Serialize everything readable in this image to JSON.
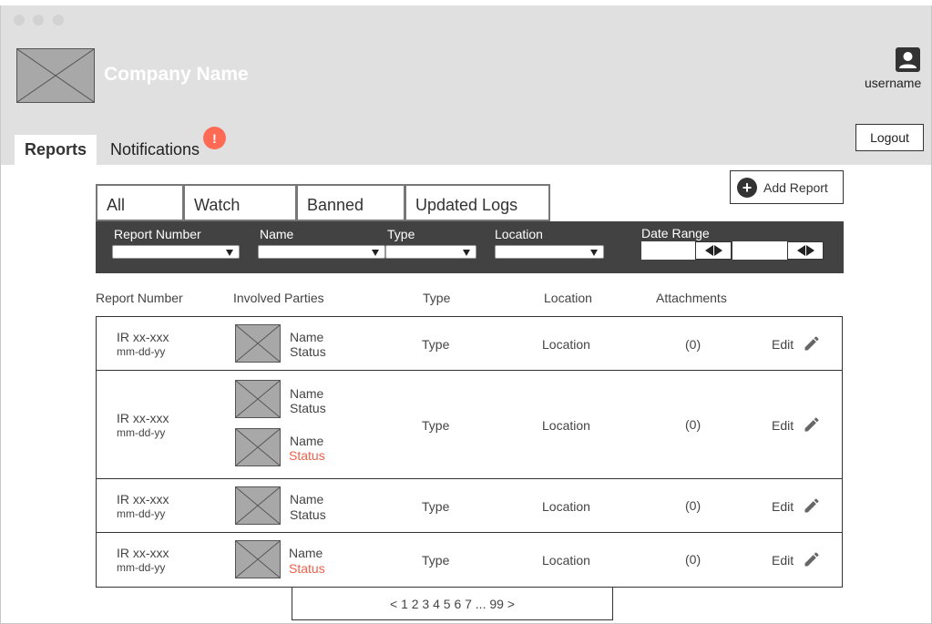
{
  "window": {
    "dots": [
      "window-dot",
      "window-dot",
      "window-dot"
    ]
  },
  "header": {
    "company_name": "Company Name",
    "username": "username",
    "logout_label": "Logout"
  },
  "nav": {
    "tabs": [
      {
        "label": "Reports",
        "active": true
      },
      {
        "label": "Notifications",
        "active": false
      }
    ],
    "notification_badge": "!"
  },
  "actions": {
    "add_report_label": "Add Report",
    "add_icon": "+"
  },
  "filter_tabs": [
    "All",
    "Watch",
    "Banned",
    "Updated Logs"
  ],
  "filters": {
    "report_number_label": "Report Number",
    "name_label": "Name",
    "type_label": "Type",
    "location_label": "Location",
    "date_range_label": "Date Range"
  },
  "table": {
    "headers": [
      "Report Number",
      "Involved Parties",
      "Type",
      "Location",
      "Attachments"
    ],
    "rows": [
      {
        "report_number": "IR xx-xxx",
        "date": "mm-dd-yy",
        "parties": [
          {
            "name": "Name",
            "status": "Status",
            "status_alert": false
          }
        ],
        "type": "Type",
        "location": "Location",
        "attachments": "(0)",
        "edit_label": "Edit"
      },
      {
        "report_number": "IR xx-xxx",
        "date": "mm-dd-yy",
        "parties": [
          {
            "name": "Name",
            "status": "Status",
            "status_alert": false
          },
          {
            "name": "Name",
            "status": "Status",
            "status_alert": true
          }
        ],
        "type": "Type",
        "location": "Location",
        "attachments": "(0)",
        "edit_label": "Edit"
      },
      {
        "report_number": "IR xx-xxx",
        "date": "mm-dd-yy",
        "parties": [
          {
            "name": "Name",
            "status": "Status",
            "status_alert": false
          }
        ],
        "type": "Type",
        "location": "Location",
        "attachments": "(0)",
        "edit_label": "Edit"
      },
      {
        "report_number": "IR xx-xxx",
        "date": "mm-dd-yy",
        "parties": [
          {
            "name": "Name",
            "status": "Status",
            "status_alert": true
          }
        ],
        "type": "Type",
        "location": "Location",
        "attachments": "(0)",
        "edit_label": "Edit"
      }
    ]
  },
  "pagination": {
    "text": "< 1 2 3 4 5 6 7 ... 99 >"
  },
  "colors": {
    "header_bg": "#e0e0e0",
    "filter_bar_bg": "#424242",
    "alert": "#ff6a55",
    "status_alert_text": "#f0604a"
  },
  "icons": {
    "user": "user-avatar-icon",
    "add": "plus-circle-icon",
    "edit": "pencil-icon",
    "logo": "image-placeholder-icon",
    "thumb": "image-placeholder-icon"
  }
}
